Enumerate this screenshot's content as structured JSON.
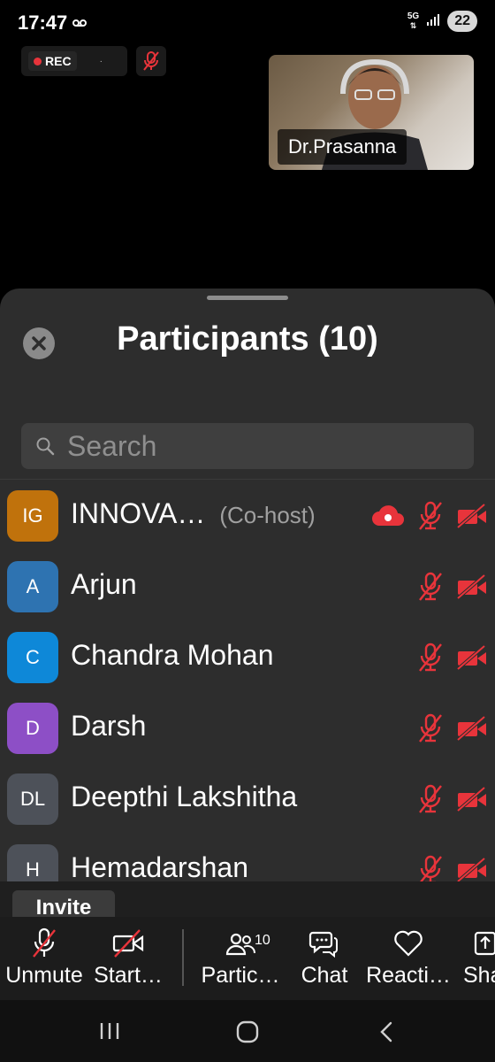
{
  "status_bar": {
    "time": "17:47",
    "network": "5G",
    "battery": "22"
  },
  "recording": {
    "label": "REC",
    "extra": "·"
  },
  "video": {
    "name": "Dr.Prasanna"
  },
  "panel": {
    "title": "Participants (10)",
    "search_placeholder": "Search"
  },
  "participants": [
    {
      "initials": "IG",
      "name": "INNOVA…",
      "role": "(Co-host)",
      "color": "#c0720c",
      "recording": true
    },
    {
      "initials": "A",
      "name": "Arjun",
      "role": "",
      "color": "#2e73b1"
    },
    {
      "initials": "C",
      "name": "Chandra Mohan",
      "role": "",
      "color": "#0e88d8"
    },
    {
      "initials": "D",
      "name": "Darsh",
      "role": "",
      "color": "#8d4fc6"
    },
    {
      "initials": "DL",
      "name": "Deepthi Lakshitha",
      "role": "",
      "color": "#4d5159"
    },
    {
      "initials": "H",
      "name": "Hemadarshan",
      "role": "",
      "color": "#4d5159"
    }
  ],
  "invite": {
    "label": "Invite"
  },
  "toolbar": {
    "unmute": "Unmute",
    "start_video": "Start…",
    "participants": "Partic…",
    "participants_count": "10",
    "chat": "Chat",
    "reactions": "Reacti…",
    "share": "Sha"
  },
  "colors": {
    "muted_red": "#e8343b",
    "sheet_bg": "#2d2d2d"
  }
}
